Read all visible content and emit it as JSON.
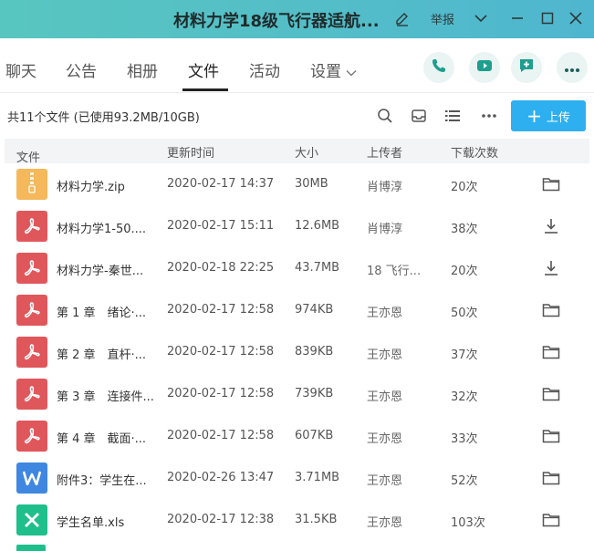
{
  "window": {
    "title": "材料力学18级飞行器适航...",
    "report_label": "举报"
  },
  "tabs": [
    {
      "label": "聊天",
      "active": false
    },
    {
      "label": "公告",
      "active": false
    },
    {
      "label": "相册",
      "active": false
    },
    {
      "label": "文件",
      "active": true
    },
    {
      "label": "活动",
      "active": false
    },
    {
      "label": "设置",
      "active": false
    }
  ],
  "toolbar": {
    "summary": "共11个文件 (已使用93.2MB/10GB)",
    "upload_label": "上传"
  },
  "columns": {
    "name": "文件",
    "time": "更新时间",
    "size": "大小",
    "uploader": "上传者",
    "downloads": "下载次数"
  },
  "files": [
    {
      "name": "材料力学.zip",
      "time": "2020-02-17 14:37",
      "size": "30MB",
      "uploader": "肖博淳",
      "downloads": "20次",
      "type": "zip",
      "action": "folder-icon"
    },
    {
      "name": "材料力学1-50....",
      "time": "2020-02-17 15:11",
      "size": "12.6MB",
      "uploader": "肖博淳",
      "downloads": "38次",
      "type": "pdf",
      "action": "download-icon"
    },
    {
      "name": "材料力学-秦世...",
      "time": "2020-02-18 22:25",
      "size": "43.7MB",
      "uploader": "18 飞行...",
      "downloads": "20次",
      "type": "pdf",
      "action": "download-icon"
    },
    {
      "name": "第 1 章　绪论·...",
      "time": "2020-02-17 12:58",
      "size": "974KB",
      "uploader": "王亦恩",
      "downloads": "50次",
      "type": "pdf",
      "action": "folder-icon"
    },
    {
      "name": "第 2 章　直杆·...",
      "time": "2020-02-17 12:58",
      "size": "839KB",
      "uploader": "王亦恩",
      "downloads": "37次",
      "type": "pdf",
      "action": "folder-icon"
    },
    {
      "name": "第 3 章　连接件...",
      "time": "2020-02-17 12:58",
      "size": "739KB",
      "uploader": "王亦恩",
      "downloads": "32次",
      "type": "pdf",
      "action": "folder-icon"
    },
    {
      "name": "第 4 章　截面·...",
      "time": "2020-02-17 12:58",
      "size": "607KB",
      "uploader": "王亦恩",
      "downloads": "33次",
      "type": "pdf",
      "action": "folder-icon"
    },
    {
      "name": "附件3：学生在...",
      "time": "2020-02-26 13:47",
      "size": "3.71MB",
      "uploader": "王亦恩",
      "downloads": "52次",
      "type": "doc",
      "action": "folder-icon"
    },
    {
      "name": "学生名单.xls",
      "time": "2020-02-17 12:38",
      "size": "31.5KB",
      "uploader": "王亦恩",
      "downloads": "103次",
      "type": "xls",
      "action": "folder-icon"
    }
  ],
  "colors": {
    "titlebar_start": "#58c6c0",
    "accent": "#2eaff0",
    "pdf": "#e0575b",
    "zip": "#f5b85a",
    "doc": "#3f87e0",
    "xls": "#1fbf8b"
  }
}
